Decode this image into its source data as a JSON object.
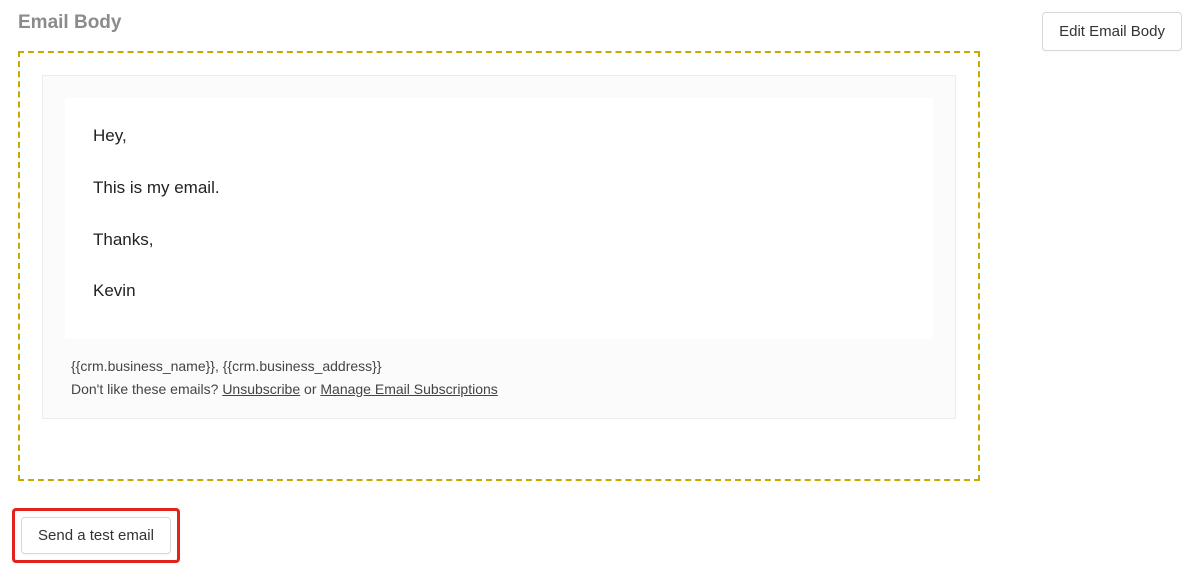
{
  "header": {
    "title": "Email Body",
    "edit_button_label": "Edit Email Body"
  },
  "email": {
    "lines": {
      "l0": "Hey,",
      "l1": "This is my email.",
      "l2": "Thanks,",
      "l3": "Kevin"
    }
  },
  "footer": {
    "merge_tags": "{{crm.business_name}}, {{crm.business_address}}",
    "prefix": "Don't like these emails? ",
    "unsubscribe": "Unsubscribe",
    "or": " or ",
    "manage": "Manage Email Subscriptions"
  },
  "actions": {
    "send_test_label": "Send a test email"
  }
}
